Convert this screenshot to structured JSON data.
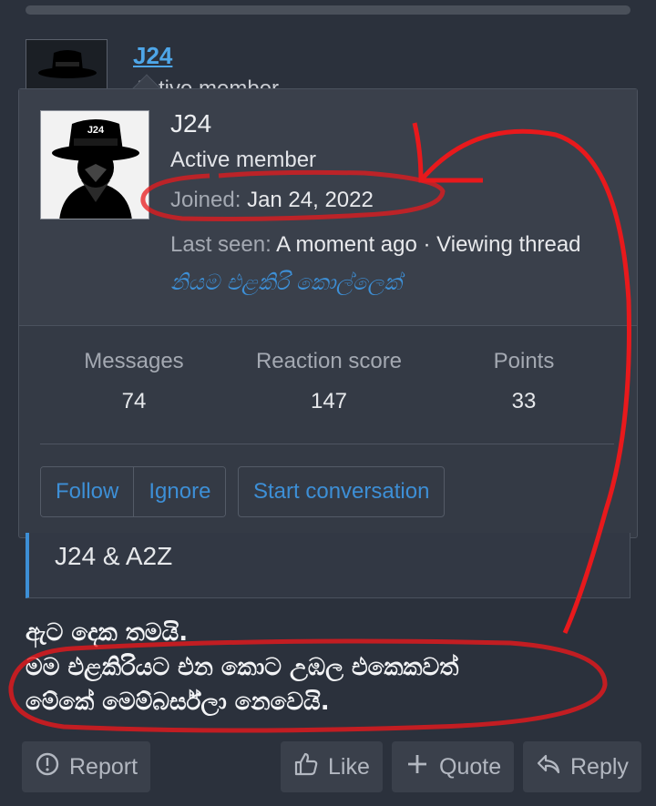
{
  "post": {
    "username": "J24",
    "user_title_partial": "Active member",
    "quote_author": "J24 & A2Z",
    "text_lines": [
      "ඇට දෙක තමයි.",
      "මම එළකිරියට එන කොට උඹල එකෙකවත්",
      "මේකේ මෙම්බර්ස්ලා නෙවෙයි."
    ]
  },
  "popup": {
    "username": "J24",
    "user_title": "Active member",
    "joined_label": "Joined:",
    "joined_date": "Jan 24, 2022",
    "last_seen_label": "Last seen:",
    "last_seen_value": "A moment ago · Viewing thread",
    "custom_title": "නියම එළකිරි කොල්ලෙක්",
    "stats": [
      {
        "label": "Messages",
        "value": "74"
      },
      {
        "label": "Reaction score",
        "value": "147"
      },
      {
        "label": "Points",
        "value": "33"
      }
    ],
    "buttons": {
      "follow": "Follow",
      "ignore": "Ignore",
      "start_conversation": "Start conversation"
    }
  },
  "actions": {
    "report": "Report",
    "like": "Like",
    "quote": "Quote",
    "reply": "Reply"
  },
  "icons": {
    "report": "alert-circle-icon",
    "like": "thumbs-up-icon",
    "quote": "plus-icon",
    "reply": "reply-icon"
  },
  "colors": {
    "background": "#2b313c",
    "popup": "#343a45",
    "link": "#3d8fd6",
    "annotation": "#e8191c"
  }
}
